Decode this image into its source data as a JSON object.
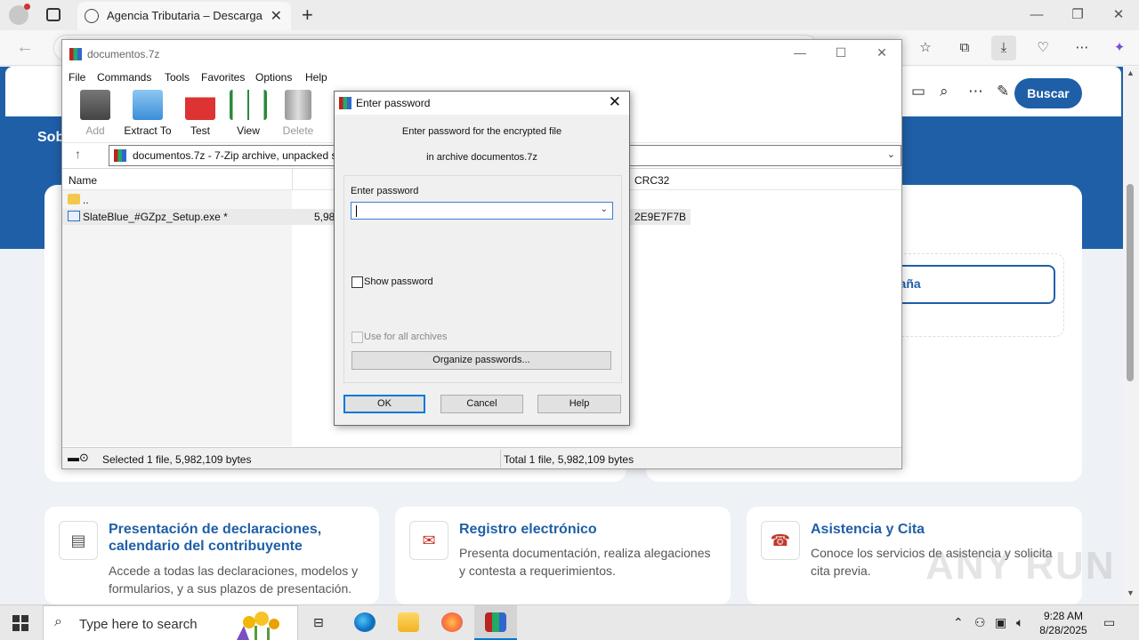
{
  "browser": {
    "tab_title": "Agencia Tributaria – Descarga de",
    "search_button": "Buscar"
  },
  "web": {
    "nav_item": "Sob",
    "location_link_fragment": "paña",
    "cards": [
      {
        "title": "Presentación de declaraciones, calendario del contribuyente",
        "text": "Accede a todas las declaraciones, modelos y formularios, y a sus plazos de presentación."
      },
      {
        "title": "Registro electrónico",
        "text": "Presenta documentación, realiza alegaciones y contesta a requerimientos."
      },
      {
        "title": "Asistencia y Cita",
        "text": "Conoce los servicios de asistencia y solicita cita previa."
      }
    ],
    "watermark": "ANY RUN"
  },
  "winrar": {
    "title": "documentos.7z",
    "menu": [
      "File",
      "Commands",
      "Tools",
      "Favorites",
      "Options",
      "Help"
    ],
    "toolbar": [
      {
        "label": "Add",
        "icon": "add-icon",
        "disabled": true
      },
      {
        "label": "Extract To",
        "icon": "extract-folder-icon",
        "disabled": false
      },
      {
        "label": "Test",
        "icon": "test-clipboard-icon",
        "disabled": false
      },
      {
        "label": "View",
        "icon": "view-book-icon",
        "disabled": false
      },
      {
        "label": "Delete",
        "icon": "trash-icon",
        "disabled": true
      }
    ],
    "path": "documentos.7z - 7-Zip archive, unpacked s",
    "columns": {
      "name": "Name",
      "crc": "CRC32"
    },
    "rows": [
      {
        "name": "..",
        "size": "",
        "crc": ""
      },
      {
        "name": "SlateBlue_#GZpz_Setup.exe *",
        "size": "5,98",
        "crc": "2E9E7F7B"
      }
    ],
    "status_left": "Selected 1 file, 5,982,109 bytes",
    "status_right": "Total 1 file, 5,982,109 bytes"
  },
  "dialog": {
    "title": "Enter password",
    "message_line1": "Enter password for the encrypted file",
    "message_line2": "in archive documentos.7z",
    "field_label": "Enter password",
    "password_value": "",
    "show_password": "Show password",
    "use_for_all": "Use for all archives",
    "organize": "Organize passwords...",
    "ok": "OK",
    "cancel": "Cancel",
    "help": "Help"
  },
  "taskbar": {
    "search_placeholder": "Type here to search",
    "time": "9:28 AM",
    "date": "8/28/2025"
  }
}
